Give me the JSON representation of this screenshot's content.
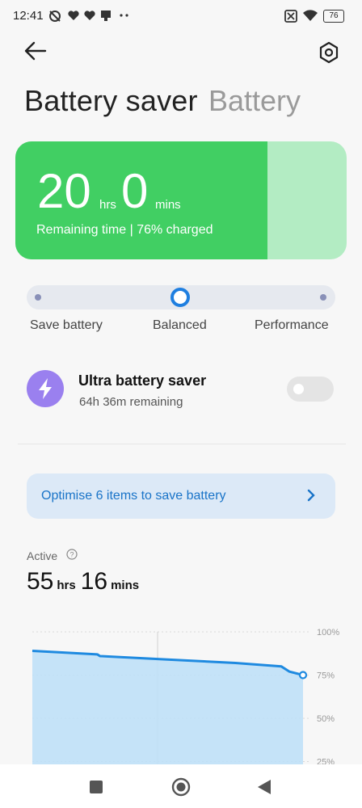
{
  "status_bar": {
    "time": "12:41",
    "icons": [
      "mute-alarm-icon",
      "heart-icon",
      "heart-icon",
      "notification-icon",
      "more-icon",
      "no-sim-icon",
      "wifi-icon",
      "battery-icon"
    ],
    "battery_level": "76"
  },
  "header": {
    "back_icon": "back-arrow-icon",
    "settings_icon": "settings-hexagon-icon",
    "title": "Battery saver",
    "title_secondary": "Battery"
  },
  "card": {
    "hours": "20",
    "hours_unit": "hrs",
    "minutes": "0",
    "minutes_unit": "mins",
    "status": "Remaining time | 76% charged",
    "charge_fraction": 0.76,
    "fill_color": "#41cf63",
    "empty_color": "#b3ecc3"
  },
  "mode": {
    "options": [
      "Save battery",
      "Balanced",
      "Performance"
    ],
    "selected": "Balanced",
    "accent": "#1f7fe0"
  },
  "ultra": {
    "icon": "lightning-icon",
    "title": "Ultra battery saver",
    "subtitle": "64h 36m remaining",
    "enabled": false
  },
  "optimise": {
    "label": "Optimise 6 items to save battery",
    "chevron": "chevron-right-icon"
  },
  "active": {
    "label": "Active",
    "help_icon": "help-circle-icon",
    "hours": "55",
    "hours_unit": "hrs",
    "minutes": "16",
    "minutes_unit": "mins"
  },
  "chart_data": {
    "type": "area",
    "x": [
      0,
      0.24,
      0.25,
      0.5,
      0.75,
      0.92,
      0.95,
      1.0
    ],
    "values": [
      89,
      87,
      86,
      84,
      82,
      80,
      77,
      75
    ],
    "y_ticks": [
      "100%",
      "75%",
      "50%",
      "25%"
    ],
    "ylim": [
      0,
      100
    ],
    "grid": true,
    "line_color": "#1f8ae0",
    "fill_color": "#bfe0f7"
  },
  "nav": {
    "items": [
      "recents-square-icon",
      "home-circle-icon",
      "back-triangle-icon"
    ]
  }
}
